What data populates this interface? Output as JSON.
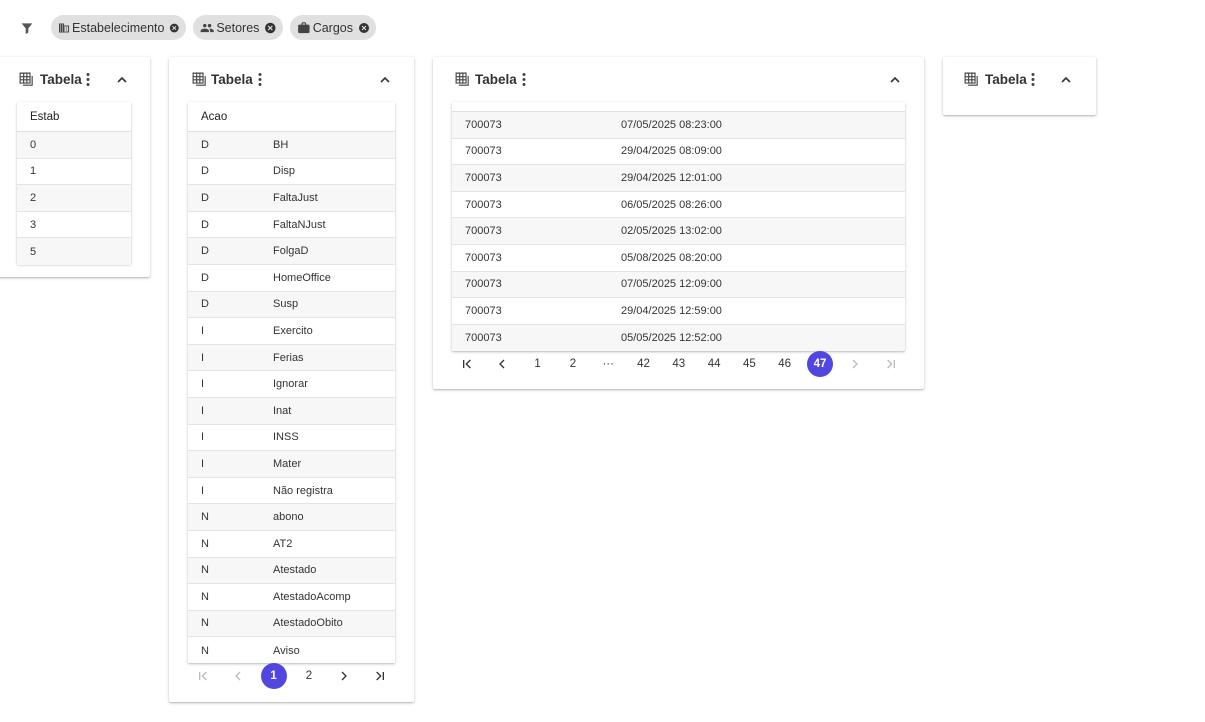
{
  "filters": {
    "chips": [
      {
        "label": "Estabelecimento",
        "icon": "building-icon"
      },
      {
        "label": "Setores",
        "icon": "people-icon"
      },
      {
        "label": "Cargos",
        "icon": "briefcase-icon"
      }
    ]
  },
  "cards": [
    {
      "title": "Tabela"
    },
    {
      "title": "Tabela"
    },
    {
      "title": "Tabela"
    },
    {
      "title": "Tabela"
    }
  ],
  "estab_table": {
    "header": "Estab",
    "rows": [
      "0",
      "1",
      "2",
      "3",
      "5"
    ]
  },
  "acao_table": {
    "header": "Acao",
    "rows": [
      [
        "D",
        "BH"
      ],
      [
        "D",
        "Disp"
      ],
      [
        "D",
        "FaltaJust"
      ],
      [
        "D",
        "FaltaNJust"
      ],
      [
        "D",
        "FolgaD"
      ],
      [
        "D",
        "HomeOffice"
      ],
      [
        "D",
        "Susp"
      ],
      [
        "I",
        "Exercito"
      ],
      [
        "I",
        "Ferias"
      ],
      [
        "I",
        "Ignorar"
      ],
      [
        "I",
        "Inat"
      ],
      [
        "I",
        "INSS"
      ],
      [
        "I",
        "Mater"
      ],
      [
        "I",
        "Não registra"
      ],
      [
        "N",
        "abono"
      ],
      [
        "N",
        "AT2"
      ],
      [
        "N",
        "Atestado"
      ],
      [
        "N",
        "AtestadoAcomp"
      ],
      [
        "N",
        "AtestadoObito"
      ],
      [
        "N",
        "Aviso"
      ]
    ],
    "pages": [
      "1",
      "2"
    ],
    "active_page": "1"
  },
  "records_table": {
    "rows": [
      [
        "700073",
        "07/05/2025 08:23:00"
      ],
      [
        "700073",
        "29/04/2025 08:09:00"
      ],
      [
        "700073",
        "29/04/2025 12:01:00"
      ],
      [
        "700073",
        "06/05/2025 08:26:00"
      ],
      [
        "700073",
        "02/05/2025 13:02:00"
      ],
      [
        "700073",
        "05/08/2025 08:20:00"
      ],
      [
        "700073",
        "07/05/2025 12:09:00"
      ],
      [
        "700073",
        "29/04/2025 12:59:00"
      ],
      [
        "700073",
        "05/05/2025 12:52:00"
      ]
    ],
    "pages": [
      "1",
      "2",
      "···",
      "42",
      "43",
      "44",
      "45",
      "46",
      "47"
    ],
    "active_page": "47"
  },
  "colors": {
    "accent": "#5146e0",
    "chip_bg": "#e0e0e0",
    "row_alt": "#f7f7f7"
  }
}
